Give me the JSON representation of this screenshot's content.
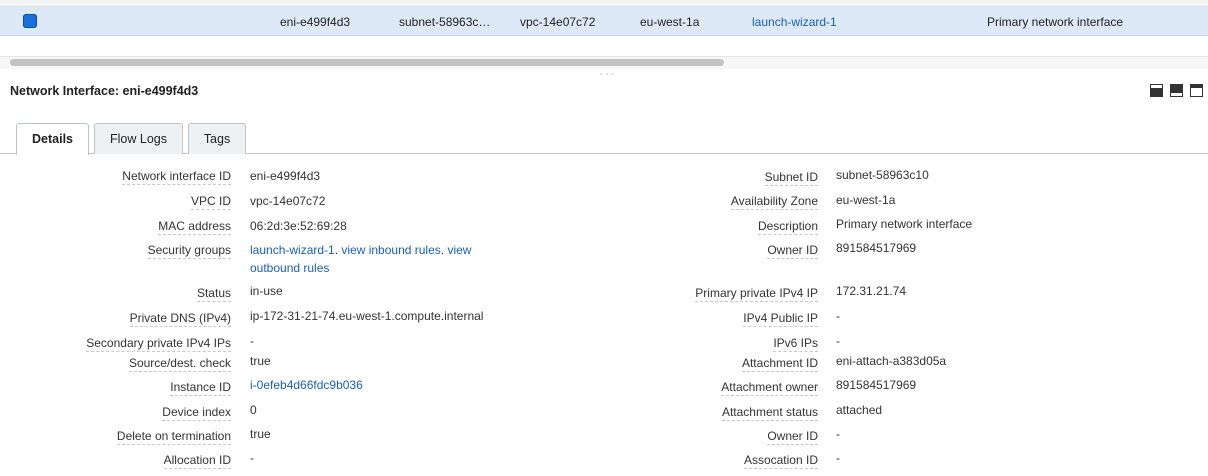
{
  "grid": {
    "row": {
      "selected": true,
      "interface_id": "eni-e499f4d3",
      "subnet": "subnet-58963c…",
      "vpc": "vpc-14e07c72",
      "zone": "eu-west-1a",
      "security_group": "launch-wizard-1",
      "description": "Primary network interface"
    }
  },
  "pane": {
    "title": "Network Interface: eni-e499f4d3",
    "layout_icons": [
      "pane-layout-bottom-icon",
      "pane-layout-split-icon",
      "pane-layout-top-icon"
    ]
  },
  "tabs": [
    {
      "label": "Details",
      "active": true
    },
    {
      "label": "Flow Logs",
      "active": false
    },
    {
      "label": "Tags",
      "active": false
    }
  ],
  "details": {
    "left": {
      "network_interface_id": {
        "label": "Network interface ID",
        "value": "eni-e499f4d3"
      },
      "vpc_id": {
        "label": "VPC ID",
        "value": "vpc-14e07c72"
      },
      "mac_address": {
        "label": "MAC address",
        "value": "06:2d:3e:52:69:28"
      },
      "security_groups": {
        "label": "Security groups",
        "group": "launch-wizard-1",
        "sep1": ". ",
        "inbound": "view inbound rules",
        "sep2": ". ",
        "outbound": "view outbound rules"
      },
      "status": {
        "label": "Status",
        "value": "in-use"
      },
      "private_dns": {
        "label": "Private DNS (IPv4)",
        "value": "ip-172-31-21-74.eu-west-1.compute.internal"
      },
      "secondary_ips": {
        "label": "Secondary private IPv4 IPs",
        "value": "-"
      },
      "source_dest": {
        "label": "Source/dest. check",
        "value": "true"
      },
      "instance_id": {
        "label": "Instance ID",
        "value": "i-0efeb4d66fdc9b036"
      },
      "device_index": {
        "label": "Device index",
        "value": "0"
      },
      "delete_on_termination": {
        "label": "Delete on termination",
        "value": "true"
      },
      "allocation_id": {
        "label": "Allocation ID",
        "value": "-"
      }
    },
    "right": {
      "subnet_id": {
        "label": "Subnet ID",
        "value": "subnet-58963c10"
      },
      "availability_zone": {
        "label": "Availability Zone",
        "value": "eu-west-1a"
      },
      "description": {
        "label": "Description",
        "value": "Primary network interface"
      },
      "owner_id": {
        "label": "Owner ID",
        "value": "891584517969"
      },
      "primary_private_ip": {
        "label": "Primary private IPv4 IP",
        "value": "172.31.21.74"
      },
      "ipv4_public_ip": {
        "label": "IPv4 Public IP",
        "value": "-"
      },
      "ipv6_ips": {
        "label": "IPv6 IPs",
        "value": "-"
      },
      "attachment_id": {
        "label": "Attachment ID",
        "value": "eni-attach-a383d05a"
      },
      "attachment_owner": {
        "label": "Attachment owner",
        "value": "891584517969"
      },
      "attachment_status": {
        "label": "Attachment status",
        "value": "attached"
      },
      "owner_id_2": {
        "label": "Owner ID",
        "value": "-"
      },
      "association_id": {
        "label": "Assocation ID",
        "value": "-"
      }
    }
  },
  "colors": {
    "link": "#1a5fb4",
    "selected_row": "#dde9f7",
    "checkbox": "#1a6fd8"
  }
}
